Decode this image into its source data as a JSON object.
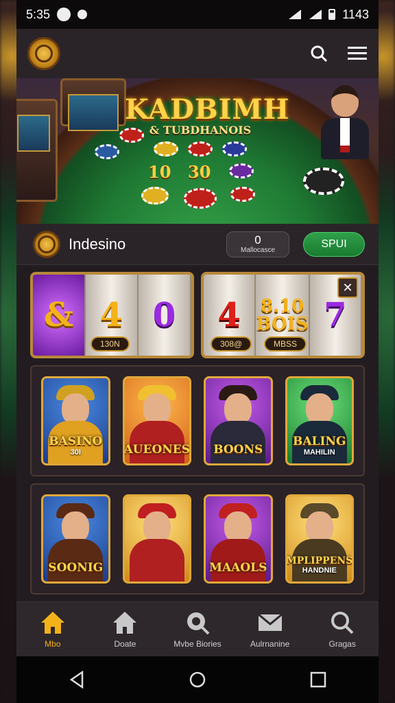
{
  "status_bar": {
    "time": "5:35",
    "right_text": "1143"
  },
  "hero": {
    "title": "KADBIMH",
    "subtitle": "& TUBDHANOIS",
    "numbers": [
      "10",
      "30"
    ],
    "chips": [
      "",
      "",
      "",
      "",
      ""
    ]
  },
  "info": {
    "brand": "Indesino",
    "counter_value": "0",
    "counter_label": "Mallocasce",
    "spin_label": "SPUI"
  },
  "slots": [
    {
      "reels": [
        "&",
        "4",
        "0"
      ],
      "label": "130N"
    },
    {
      "reels": [
        "4",
        "8.10\nBOIS",
        "7"
      ],
      "label": "308@",
      "label2": "MBSS"
    }
  ],
  "grid1": [
    {
      "title": "BASINO",
      "sub": "30I",
      "theme": "blue"
    },
    {
      "title": "AUEONES",
      "sub": "",
      "theme": "orange"
    },
    {
      "title": "BOONS",
      "sub": "",
      "theme": "purple"
    },
    {
      "title": "BALING",
      "sub": "MAHILIN",
      "theme": "green"
    }
  ],
  "grid2": [
    {
      "title": "SOONIG",
      "sub": "",
      "theme": "blue"
    },
    {
      "title": "",
      "sub": "",
      "theme": "gold"
    },
    {
      "title": "MAAOLS",
      "sub": "",
      "theme": "purple"
    },
    {
      "title": "MPLIPPENS",
      "sub": "HANDNIE",
      "theme": "gold"
    }
  ],
  "nav": [
    {
      "label": "Mbo",
      "icon": "home-icon",
      "active": true
    },
    {
      "label": "Doate",
      "icon": "house-icon",
      "active": false
    },
    {
      "label": "Mvbe Biories",
      "icon": "chip-search-icon",
      "active": false
    },
    {
      "label": "Aulrnanine",
      "icon": "mail-icon",
      "active": false
    },
    {
      "label": "Gragas",
      "icon": "search-icon",
      "active": false
    }
  ],
  "colors": {
    "accent": "#f4b21a",
    "spin": "#1a7a30",
    "gold_border": "#b8893a"
  }
}
